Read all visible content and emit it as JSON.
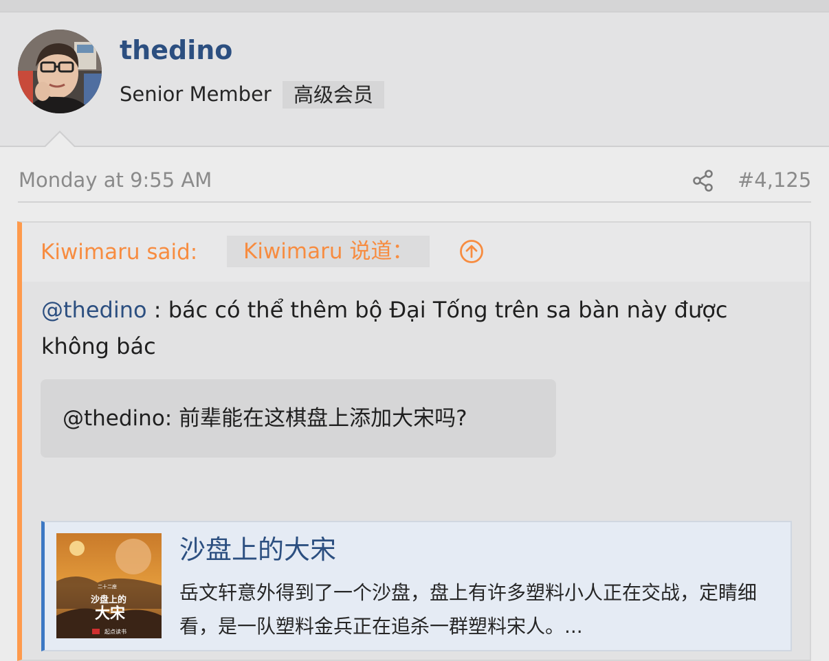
{
  "post": {
    "username": "thedino",
    "user_title": "Senior Member",
    "user_title_translation": "高级会员",
    "date": "Monday at 9:55 AM",
    "post_number": "#4,125",
    "share_icon": "share-icon"
  },
  "quote": {
    "attribution": "Kiwimaru said:",
    "attribution_translation": "Kiwimaru 说道：",
    "expand_icon": "arrow-up-circle-icon",
    "mention": "@thedino",
    "text": " : bác có thể thêm bộ Đại Tống trên sa bàn này được không bác",
    "translation": "@thedino: 前辈能在这棋盘上添加大宋吗?"
  },
  "embed": {
    "title": "沙盘上的大宋",
    "description": "岳文轩意外得到了一个沙盘，盘上有许多塑料小人正在交战，定睛细看，是一队塑料金兵正在追杀一群塑料宋人。...",
    "thumbnail": {
      "top_line": "二十二座",
      "line1": "沙盘上的",
      "line2": "大宋",
      "footer": "起点读书"
    }
  },
  "colors": {
    "username": "#2c4f80",
    "quote_accent": "#fe9a4c",
    "quote_text": "#f78c40",
    "embed_accent": "#3c78c4"
  }
}
